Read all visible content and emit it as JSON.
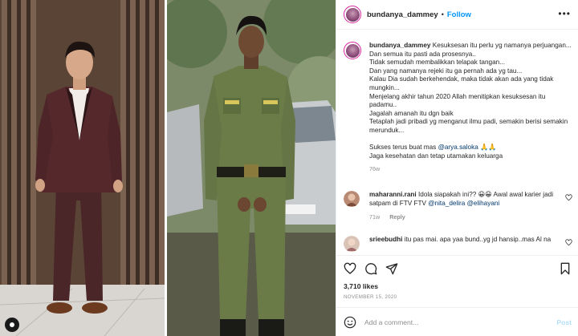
{
  "post": {
    "username": "bundanya_dammey",
    "separator": "•",
    "follow_label": "Follow",
    "more_label": "•••"
  },
  "caption": {
    "username": "bundanya_dammey",
    "lines": [
      "Kesuksesan itu perlu yg namanya perjuangan...",
      "Dan semua itu pasti ada prosesnya..",
      "Tidak semudah membalikkan telapak tangan...",
      "Dan yang namanya rejeki itu ga pernah ada yg tau...",
      "Kalau Dia sudah berkehendak, maka tidak akan ada yang tidak mungkin...",
      "Menjelang akhir tahun 2020 Allah menitipkan kesuksesan itu padamu..",
      "Jagalah amanah itu dgn baik",
      "Tetaplah jadi pribadi yg menganut ilmu padi, semakin berisi semakin merunduk..."
    ],
    "line9_prefix": "Sukses terus buat mas ",
    "line9_mention": "@arya.saloka",
    "line9_suffix": " 🙏🙏",
    "line10": "Jaga kesehatan dan tetap utamakan keluarga",
    "time": "76w"
  },
  "comments": [
    {
      "username": "maharanni.rani",
      "text_before": "Idola siapakah ini?? 😀😀 Awal awal karier jadi satpam di FTV FTV ",
      "mention1": "@nita_delira",
      "mention2": "@elihayani",
      "time": "71w",
      "reply_label": "Reply"
    },
    {
      "username": "srieebudhi",
      "text": "itu pas mai. apa yaa bund..yg jd hansip..mas Al na"
    }
  ],
  "likes": "3,710 likes",
  "date": "NOVEMBER 15, 2020",
  "add_comment": {
    "placeholder": "Add a comment...",
    "post_label": "Post"
  },
  "icons": {
    "like": "heart-icon",
    "comment": "comment-icon",
    "share": "share-icon",
    "save": "bookmark-icon",
    "emoji": "emoji-icon",
    "more": "more-icon"
  },
  "colors": {
    "accent": "#0095f6",
    "mention": "#00376b",
    "muted": "#8e8e8e",
    "text": "#262626",
    "post_disabled": "#b2dffc"
  }
}
